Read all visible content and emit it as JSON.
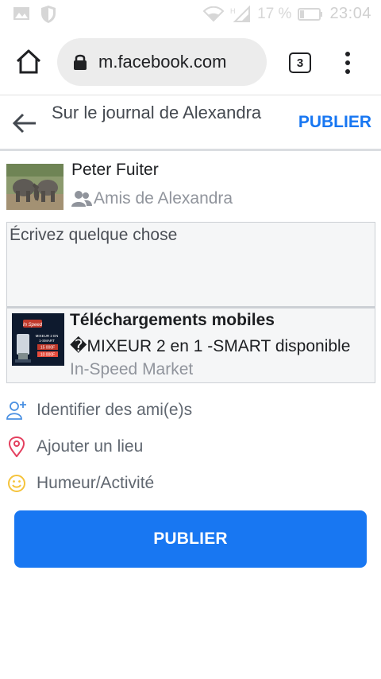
{
  "status_bar": {
    "battery_percent": "17 %",
    "time": "23:04"
  },
  "browser": {
    "url": "m.facebook.com",
    "tab_count": "3"
  },
  "header": {
    "title": "Sur le journal de Alexandra",
    "publish_label": "PUBLIER"
  },
  "author": {
    "name": "Peter Fuiter",
    "audience": "Amis de Alexandra"
  },
  "composer": {
    "placeholder": "Écrivez quelque chose"
  },
  "shared_link": {
    "title": "Téléchargements mobiles",
    "description": "�MIXEUR 2 en 1 -SMART disponible",
    "source": "In-Speed Market",
    "thumb_text": [
      "MIXEUR 2 EN",
      "1-SMART",
      "15 000F",
      "10 000F"
    ]
  },
  "options": [
    {
      "label": "Identifier des ami(e)s",
      "icon": "tag-friends-icon",
      "color": "#4a90e2"
    },
    {
      "label": "Ajouter un lieu",
      "icon": "location-pin-icon",
      "color": "#e4405f"
    },
    {
      "label": "Humeur/Activité",
      "icon": "smiley-icon",
      "color": "#f5c33b"
    }
  ],
  "publish_button": {
    "label": "PUBLIER"
  },
  "colors": {
    "accent": "#1877f2"
  }
}
